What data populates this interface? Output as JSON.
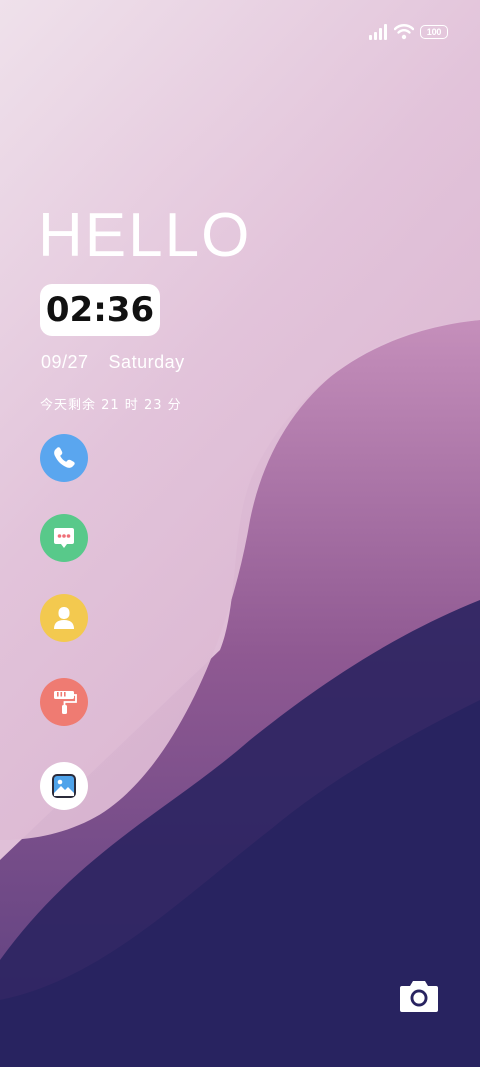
{
  "status_bar": {
    "battery_level": "100",
    "icons": [
      "signal-icon",
      "wifi-icon",
      "battery-icon"
    ]
  },
  "lock_screen": {
    "greeting": "HELLO",
    "time": "02:36",
    "date": "09/27",
    "weekday": "Saturday",
    "remaining_time": "今天剩余 21 时 23 分"
  },
  "shortcuts": [
    {
      "name": "phone",
      "icon": "phone-icon",
      "color": "#5aa6ef"
    },
    {
      "name": "messages",
      "icon": "message-icon",
      "color": "#58c98a"
    },
    {
      "name": "contacts",
      "icon": "contact-icon",
      "color": "#f3c94f"
    },
    {
      "name": "themes",
      "icon": "paint-roller-icon",
      "color": "#ef7b72"
    },
    {
      "name": "gallery",
      "icon": "gallery-icon",
      "color": "#ffffff"
    }
  ],
  "camera_shortcut": {
    "icon": "camera-icon"
  },
  "colors": {
    "background_light": "#e9d7e4",
    "background_purple": "#9a5f97",
    "background_dark": "#282360"
  }
}
